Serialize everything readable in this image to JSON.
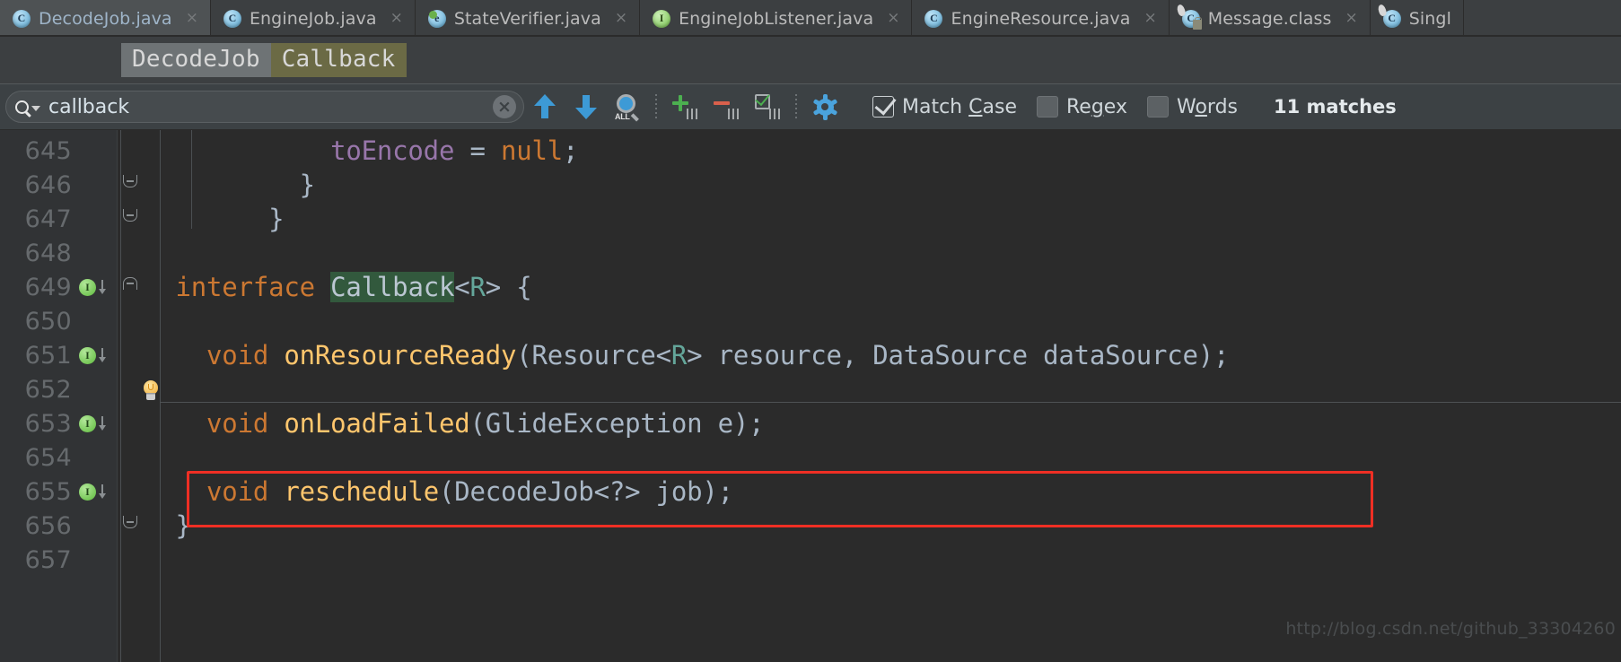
{
  "tabs": [
    {
      "label": "DecodeJob.java",
      "icon": "java-class-icon",
      "active": true,
      "close": "×"
    },
    {
      "label": "EngineJob.java",
      "icon": "java-class-icon",
      "active": false,
      "close": "×"
    },
    {
      "label": "StateVerifier.java",
      "icon": "java-enum-icon",
      "active": false,
      "close": "×"
    },
    {
      "label": "EngineJobListener.java",
      "icon": "java-interface-icon",
      "active": false,
      "close": "×"
    },
    {
      "label": "EngineResource.java",
      "icon": "java-class-icon",
      "active": false,
      "close": "×"
    },
    {
      "label": "Message.class",
      "icon": "java-class-file-icon",
      "active": false,
      "close": "×"
    },
    {
      "label": "Singl",
      "icon": "java-class-icon",
      "active": false,
      "close": ""
    }
  ],
  "breadcrumb": {
    "items": [
      {
        "label": "DecodeJob",
        "style": "gray"
      },
      {
        "label": "Callback",
        "style": "olive"
      }
    ]
  },
  "search": {
    "value": "callback",
    "placeholder": "Search",
    "clear_label": "×",
    "prev_tooltip": "Find Previous",
    "next_tooltip": "Find Next",
    "find_all_label": "ALL",
    "add_label": "+",
    "remove_label": "−",
    "select_all_label": "✓",
    "settings_label": "Filter",
    "options": [
      {
        "label_pre": "Match ",
        "label_key": "C",
        "label_post": "ase",
        "checked": true,
        "name": "match-case"
      },
      {
        "label_pre": "Re",
        "label_key": "g",
        "label_post": "ex",
        "checked": false,
        "name": "regex"
      },
      {
        "label_pre": "W",
        "label_key": "o",
        "label_post": "rds",
        "checked": false,
        "name": "words"
      }
    ],
    "match_count": "11 matches"
  },
  "editor": {
    "lines": [
      {
        "num": "645",
        "gutter": "",
        "fold": "",
        "tokens": [
          {
            "t": "            ",
            "c": "k-default"
          },
          {
            "t": "toEncode",
            "c": "k-purple"
          },
          {
            "t": " ",
            "c": "k-default"
          },
          {
            "t": "=",
            "c": "k-default"
          },
          {
            "t": " ",
            "c": "k-default"
          },
          {
            "t": "null",
            "c": "k-orange"
          },
          {
            "t": ";",
            "c": "k-default"
          }
        ]
      },
      {
        "num": "646",
        "gutter": "",
        "fold": "bot",
        "tokens": [
          {
            "t": "          }",
            "c": "k-default"
          }
        ]
      },
      {
        "num": "647",
        "gutter": "",
        "fold": "bot",
        "tokens": [
          {
            "t": "        }",
            "c": "k-default"
          }
        ]
      },
      {
        "num": "648",
        "gutter": "",
        "fold": "",
        "tokens": []
      },
      {
        "num": "649",
        "gutter": "impl",
        "fold": "top",
        "tokens": [
          {
            "t": "  ",
            "c": "k-default"
          },
          {
            "t": "interface",
            "c": "k-orange"
          },
          {
            "t": " ",
            "c": "k-default"
          },
          {
            "t": "Callback",
            "c": "k-white",
            "hl": true
          },
          {
            "t": "<",
            "c": "k-default"
          },
          {
            "t": "R",
            "c": "k-teal"
          },
          {
            "t": ">",
            "c": "k-default"
          },
          {
            "t": " {",
            "c": "k-default"
          }
        ]
      },
      {
        "num": "650",
        "gutter": "",
        "fold": "",
        "tokens": []
      },
      {
        "num": "651",
        "gutter": "impl",
        "fold": "",
        "tokens": [
          {
            "t": "    ",
            "c": "k-default"
          },
          {
            "t": "void",
            "c": "k-orange"
          },
          {
            "t": " ",
            "c": "k-default"
          },
          {
            "t": "onResourceReady",
            "c": "k-method"
          },
          {
            "t": "(",
            "c": "k-default"
          },
          {
            "t": "Resource",
            "c": "k-default"
          },
          {
            "t": "<",
            "c": "k-default"
          },
          {
            "t": "R",
            "c": "k-teal"
          },
          {
            "t": ">",
            "c": "k-default"
          },
          {
            "t": " resource, ",
            "c": "k-default"
          },
          {
            "t": "DataSource",
            "c": "k-default"
          },
          {
            "t": " dataSource);",
            "c": "k-default"
          }
        ]
      },
      {
        "num": "652",
        "gutter": "",
        "fold": "",
        "tokens": []
      },
      {
        "num": "653",
        "gutter": "impl",
        "fold": "",
        "tokens": [
          {
            "t": "    ",
            "c": "k-default"
          },
          {
            "t": "void",
            "c": "k-orange"
          },
          {
            "t": " ",
            "c": "k-default"
          },
          {
            "t": "onLoadFailed",
            "c": "k-method"
          },
          {
            "t": "(",
            "c": "k-default"
          },
          {
            "t": "GlideException",
            "c": "k-default"
          },
          {
            "t": " e);",
            "c": "k-default"
          }
        ]
      },
      {
        "num": "654",
        "gutter": "",
        "fold": "",
        "tokens": []
      },
      {
        "num": "655",
        "gutter": "impl",
        "fold": "",
        "tokens": [
          {
            "t": "    ",
            "c": "k-default"
          },
          {
            "t": "void",
            "c": "k-orange"
          },
          {
            "t": " ",
            "c": "k-default"
          },
          {
            "t": "reschedule",
            "c": "k-method"
          },
          {
            "t": "(",
            "c": "k-default"
          },
          {
            "t": "DecodeJob",
            "c": "k-default"
          },
          {
            "t": "<?> job);",
            "c": "k-default"
          }
        ]
      },
      {
        "num": "656",
        "gutter": "",
        "fold": "bot",
        "tokens": [
          {
            "t": "  }",
            "c": "k-default"
          }
        ]
      },
      {
        "num": "657",
        "gutter": "",
        "fold": "",
        "tokens": []
      }
    ],
    "intention_bulb": "lightbulb-icon",
    "annotation_box_color": "#ef2f24",
    "watermark": "http://blog.csdn.net/github_33304260"
  },
  "colors": {
    "accent_blue": "#3d9ad6",
    "keyword_orange": "#cc7832",
    "field_purple": "#9876aa",
    "method_yellow": "#ffc66d",
    "search_highlight": "#32593d",
    "editor_bg": "#2b2b2b",
    "gutter_bg": "#313335",
    "chrome_bg": "#3c3f41"
  }
}
